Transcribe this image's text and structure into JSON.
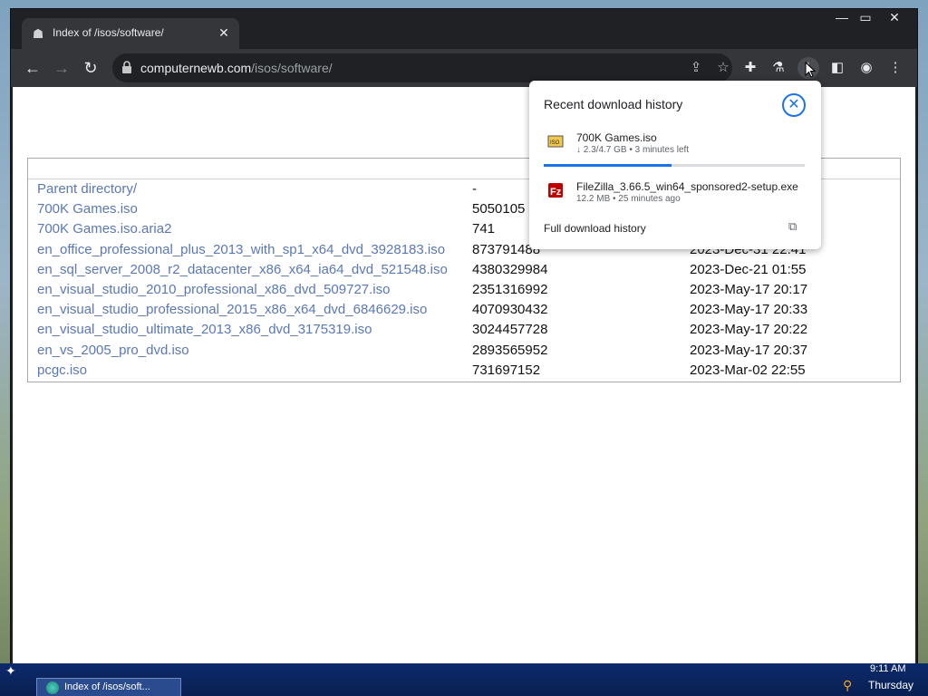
{
  "tab": {
    "title": "Index of /isos/software/",
    "close": "✕"
  },
  "window_controls": {
    "minimize": "—",
    "maximize": "▭",
    "close": "✕"
  },
  "toolbar": {
    "back": "←",
    "forward": "→",
    "reload": "↻",
    "url_host": "computernewb.com",
    "url_path": "/isos/software/"
  },
  "listing": {
    "rows": [
      {
        "name": "Parent directory/",
        "size": "-",
        "date": ""
      },
      {
        "name": "700K Games.iso",
        "size": "5050105",
        "date": ""
      },
      {
        "name": "700K Games.iso.aria2",
        "size": "741",
        "date": ""
      },
      {
        "name": "en_office_professional_plus_2013_with_sp1_x64_dvd_3928183.iso",
        "size": "873791488",
        "date": "2023-Dec-31 22:41"
      },
      {
        "name": "en_sql_server_2008_r2_datacenter_x86_x64_ia64_dvd_521548.iso",
        "size": "4380329984",
        "date": "2023-Dec-21 01:55"
      },
      {
        "name": "en_visual_studio_2010_professional_x86_dvd_509727.iso",
        "size": "2351316992",
        "date": "2023-May-17 20:17"
      },
      {
        "name": "en_visual_studio_professional_2015_x86_x64_dvd_6846629.iso",
        "size": "4070930432",
        "date": "2023-May-17 20:33"
      },
      {
        "name": "en_visual_studio_ultimate_2013_x86_dvd_3175319.iso",
        "size": "3024457728",
        "date": "2023-May-17 20:22"
      },
      {
        "name": "en_vs_2005_pro_dvd.iso",
        "size": "2893565952",
        "date": "2023-May-17 20:37"
      },
      {
        "name": "pcgc.iso",
        "size": "731697152",
        "date": "2023-Mar-02 22:55"
      }
    ]
  },
  "download_popup": {
    "title": "Recent download history",
    "items": [
      {
        "name": "700K Games.iso",
        "status": "↓ 2.3/4.7 GB • 3 minutes left",
        "progress": 0.49
      },
      {
        "name": "FileZilla_3.66.5_win64_sponsored2-setup.exe",
        "status": "12.2 MB • 25 minutes ago"
      }
    ],
    "full_history": "Full download history"
  },
  "taskbar": {
    "task_label": "Index of /isos/soft...",
    "time": "9:11 AM",
    "day": "Thursday"
  }
}
